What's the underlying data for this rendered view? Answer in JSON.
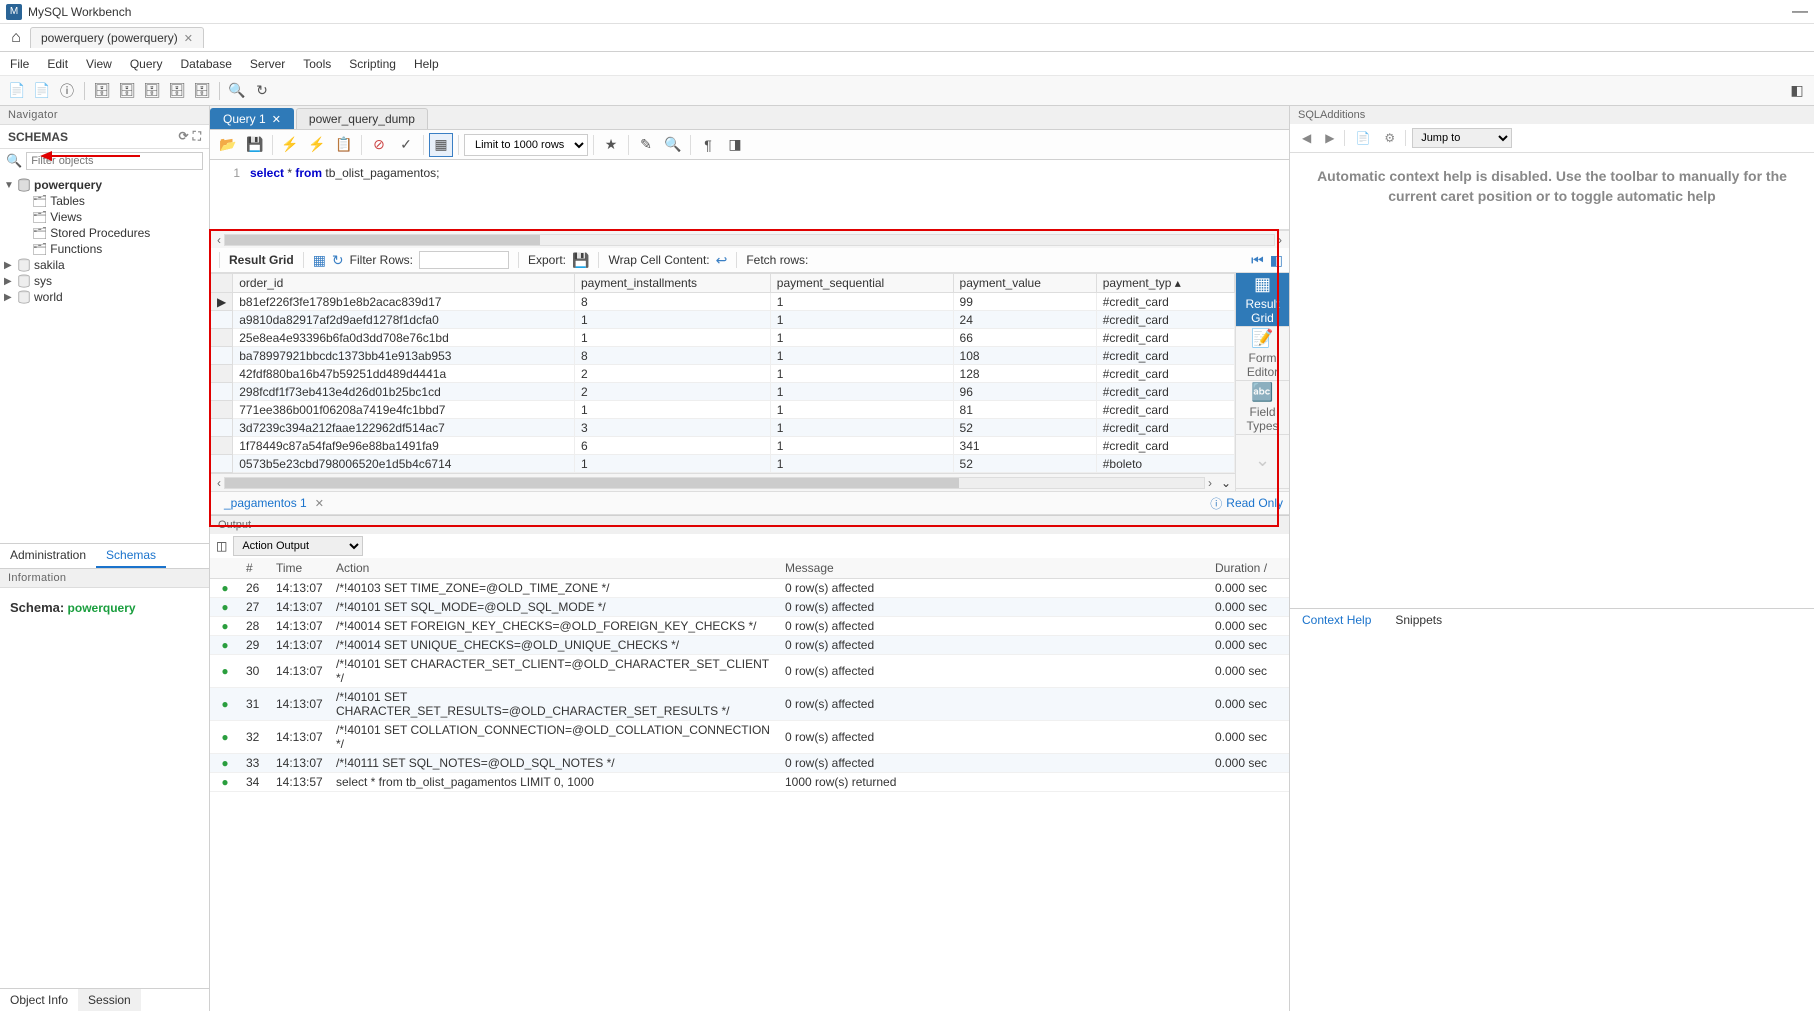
{
  "app_title": "MySQL Workbench",
  "doc_tab": "powerquery (powerquery)",
  "menu": [
    "File",
    "Edit",
    "View",
    "Query",
    "Database",
    "Server",
    "Tools",
    "Scripting",
    "Help"
  ],
  "navigator": {
    "header": "Navigator",
    "schemas_label": "SCHEMAS",
    "filter_placeholder": "Filter objects",
    "tree": {
      "powerquery": {
        "name": "powerquery",
        "children": [
          "Tables",
          "Views",
          "Stored Procedures",
          "Functions"
        ]
      },
      "others": [
        "sakila",
        "sys",
        "world"
      ]
    },
    "tabs": {
      "administration": "Administration",
      "schemas": "Schemas"
    }
  },
  "information": {
    "header": "Information",
    "schema_label": "Schema:",
    "schema_name": "powerquery",
    "tabs": {
      "object_info": "Object Info",
      "session": "Session"
    }
  },
  "query_tabs": [
    {
      "label": "Query 1",
      "active": true
    },
    {
      "label": "power_query_dump",
      "active": false
    }
  ],
  "editor_toolbar": {
    "limit_label": "Limit to 1000 rows"
  },
  "sql": {
    "lineno": "1",
    "select": "select",
    "star": " * ",
    "from": "from",
    "rest": " tb_olist_pagamentos;"
  },
  "result_toolbar": {
    "label": "Result Grid",
    "filter": "Filter Rows:",
    "export": "Export:",
    "wrap": "Wrap Cell Content:",
    "fetch": "Fetch rows:"
  },
  "grid": {
    "columns": [
      "order_id",
      "payment_installments",
      "payment_sequential",
      "payment_value",
      "payment_typ"
    ],
    "rows": [
      [
        "b81ef226f3fe1789b1e8b2acac839d17",
        "8",
        "1",
        "99",
        "#credit_card"
      ],
      [
        "a9810da82917af2d9aefd1278f1dcfa0",
        "1",
        "1",
        "24",
        "#credit_card"
      ],
      [
        "25e8ea4e93396b6fa0d3dd708e76c1bd",
        "1",
        "1",
        "66",
        "#credit_card"
      ],
      [
        "ba78997921bbcdc1373bb41e913ab953",
        "8",
        "1",
        "108",
        "#credit_card"
      ],
      [
        "42fdf880ba16b47b59251dd489d4441a",
        "2",
        "1",
        "128",
        "#credit_card"
      ],
      [
        "298fcdf1f73eb413e4d26d01b25bc1cd",
        "2",
        "1",
        "96",
        "#credit_card"
      ],
      [
        "771ee386b001f06208a7419e4fc1bbd7",
        "1",
        "1",
        "81",
        "#credit_card"
      ],
      [
        "3d7239c394a212faae122962df514ac7",
        "3",
        "1",
        "52",
        "#credit_card"
      ],
      [
        "1f78449c87a54faf9e96e88ba1491fa9",
        "6",
        "1",
        "341",
        "#credit_card"
      ],
      [
        "0573b5e23cbd798006520e1d5b4c6714",
        "1",
        "1",
        "52",
        "#boleto"
      ]
    ]
  },
  "side_tabs": [
    {
      "label": "Result\nGrid",
      "active": true
    },
    {
      "label": "Form\nEditor",
      "active": false
    },
    {
      "label": "Field\nTypes",
      "active": false
    }
  ],
  "result_footer": {
    "tab": "_pagamentos 1",
    "readonly": "Read Only"
  },
  "output": {
    "header": "Output",
    "selector": "Action Output",
    "columns": [
      "",
      "#",
      "Time",
      "Action",
      "Message",
      "Duration /"
    ],
    "rows": [
      [
        "ok",
        "26",
        "14:13:07",
        "/*!40103 SET TIME_ZONE=@OLD_TIME_ZONE */",
        "0 row(s) affected",
        "0.000 sec"
      ],
      [
        "ok",
        "27",
        "14:13:07",
        "/*!40101 SET SQL_MODE=@OLD_SQL_MODE */",
        "0 row(s) affected",
        "0.000 sec"
      ],
      [
        "ok",
        "28",
        "14:13:07",
        "/*!40014 SET FOREIGN_KEY_CHECKS=@OLD_FOREIGN_KEY_CHECKS */",
        "0 row(s) affected",
        "0.000 sec"
      ],
      [
        "ok",
        "29",
        "14:13:07",
        "/*!40014 SET UNIQUE_CHECKS=@OLD_UNIQUE_CHECKS */",
        "0 row(s) affected",
        "0.000 sec"
      ],
      [
        "ok",
        "30",
        "14:13:07",
        "/*!40101 SET CHARACTER_SET_CLIENT=@OLD_CHARACTER_SET_CLIENT */",
        "0 row(s) affected",
        "0.000 sec"
      ],
      [
        "ok",
        "31",
        "14:13:07",
        "/*!40101 SET CHARACTER_SET_RESULTS=@OLD_CHARACTER_SET_RESULTS */",
        "0 row(s) affected",
        "0.000 sec"
      ],
      [
        "ok",
        "32",
        "14:13:07",
        "/*!40101 SET COLLATION_CONNECTION=@OLD_COLLATION_CONNECTION */",
        "0 row(s) affected",
        "0.000 sec"
      ],
      [
        "ok",
        "33",
        "14:13:07",
        "/*!40111 SET SQL_NOTES=@OLD_SQL_NOTES */",
        "0 row(s) affected",
        "0.000 sec"
      ],
      [
        "ok",
        "34",
        "14:13:57",
        "select * from tb_olist_pagamentos LIMIT 0, 1000",
        "1000 row(s) returned",
        ""
      ]
    ]
  },
  "sql_additions": {
    "header": "SQLAdditions",
    "jump": "Jump to",
    "help_text": "Automatic context help is disabled. Use the toolbar to manually for the current caret position or to toggle automatic help",
    "tabs": {
      "context_help": "Context Help",
      "snippets": "Snippets"
    }
  }
}
